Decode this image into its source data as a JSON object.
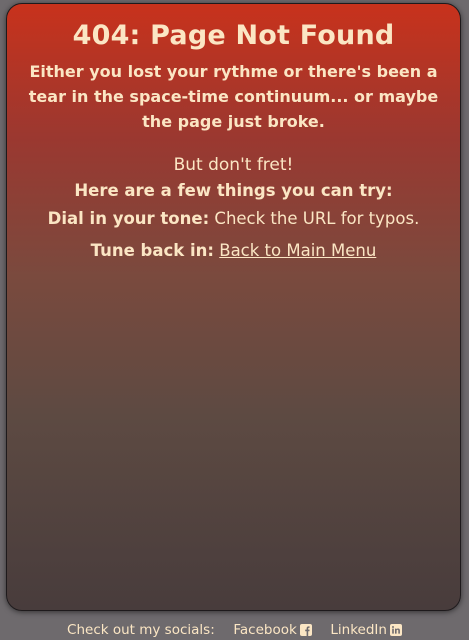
{
  "main": {
    "title": "404: Page Not Found",
    "intro": "Either you lost your rythme or there's been a tear in the space-time continuum... or maybe the page just broke.",
    "dont_fret": "But don't fret!",
    "try_text": "Here are a few things you can try:",
    "tip1_label": "Dial in your tone:",
    "tip1_text": " Check the URL for typos.",
    "tip2_label": "Tune back in:",
    "tip2_link": "Back to Main Menu"
  },
  "footer": {
    "label": "Check out my socials:",
    "facebook": "Facebook",
    "linkedin": "LinkedIn",
    "facebook_icon": "facebook-square-icon",
    "linkedin_icon": "linkedin-square-icon"
  },
  "colors": {
    "text": "#fbe6c4",
    "gradient_top": "#c8321c",
    "gradient_bottom": "#483c3c",
    "page_background": "#6e6a6d"
  }
}
